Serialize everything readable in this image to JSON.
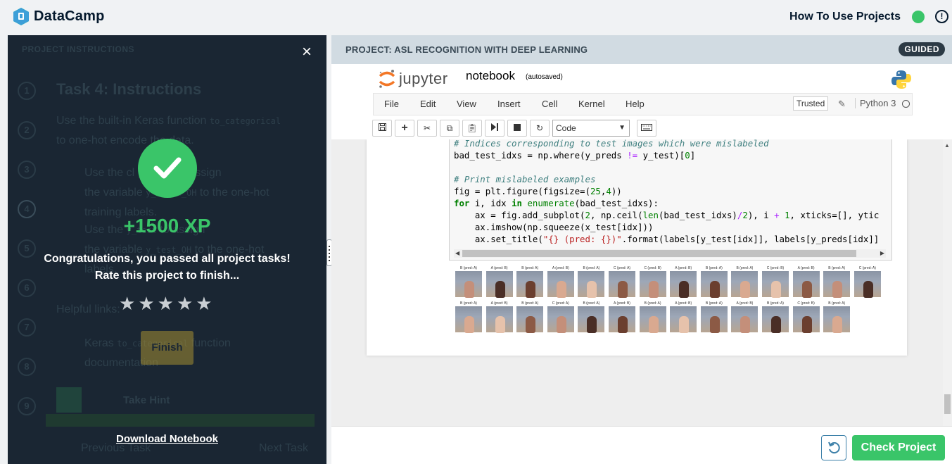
{
  "app": {
    "brand": "DataCamp"
  },
  "header": {
    "how_to": "How To Use Projects",
    "status_color": "#3ac569",
    "alert_icon": "!"
  },
  "left_panel": {
    "section_label": "PROJECT INSTRUCTIONS",
    "steps": [
      "1",
      "2",
      "3",
      "4",
      "5",
      "6",
      "7",
      "8",
      "9"
    ],
    "task_title": "Task 4: Instructions",
    "intro_line1": "Use the built-in Keras function",
    "intro_code": "to_categorical",
    "intro_line2": "to one-hot encode the data.",
    "bullet1_a": "Use the cl",
    "bullet1_code": "y_train",
    "bullet1_b": "to assign",
    "bullet1_c": "the variable",
    "bullet1_code2": "y_train_OH",
    "bullet1_d": "to the one-hot",
    "bullet1_e": "training labels.",
    "bullet2_a": "Use the",
    "bullet2_code": "y_test",
    "bullet2_b": "to assign",
    "bullet2_c": "the variable",
    "bullet2_code2": "y_test_OH",
    "bullet2_d": "to the one-hot",
    "bullet2_e": "labels.",
    "helpful_links": "Helpful links:",
    "link_a": "Keras",
    "link_code": "to_categorical",
    "link_b": "function",
    "link_c": "documentation",
    "bg_finish": "Finish",
    "take_hint": "Take Hint",
    "previous": "Previous Task",
    "next": "Next Task"
  },
  "modal": {
    "close_icon": "×",
    "xp": "+1500 XP",
    "congrats_line1": "Congratulations, you passed all project tasks!",
    "congrats_line2": "Rate this project to finish...",
    "stars": 5,
    "download": "Download Notebook"
  },
  "project": {
    "title": "PROJECT: ASL RECOGNITION WITH DEEP LEARNING",
    "badge": "GUIDED"
  },
  "jupyter": {
    "logo_text": "jupyter",
    "notebook_name": "notebook",
    "autosaved": "(autosaved)",
    "menu": [
      "File",
      "Edit",
      "View",
      "Insert",
      "Cell",
      "Kernel",
      "Help"
    ],
    "trusted": "Trusted",
    "kernel": "Python 3",
    "cell_type": "Code",
    "code": [
      "# Indices corresponding to test images which were mislabeled",
      "bad_test_idxs = np.where(y_preds != y_test)[0]",
      "",
      "# Print mislabeled examples",
      "fig = plt.figure(figsize=(25,4))",
      "for i, idx in enumerate(bad_test_idxs):",
      "    ax = fig.add_subplot(2, np.ceil(len(bad_test_idxs)/2), i + 1, xticks=[], ytic",
      "    ax.imshow(np.squeeze(x_test[idx]))",
      "    ax.set_title(\"{} (pred: {})\".format(labels[y_test[idx]], labels[y_preds[idx]]"
    ],
    "row1_labels": [
      "B (pred: A)",
      "A (pred: B)",
      "B (pred: A)",
      "A (pred: B)",
      "B (pred: A)",
      "C (pred: A)",
      "C (pred: B)",
      "A (pred: B)",
      "B (pred: A)",
      "B (pred: A)",
      "C (pred: B)",
      "A (pred: B)",
      "B (pred: A)",
      "C (pred: A)"
    ],
    "row2_labels": [
      "B (pred: A)",
      "A (pred: B)",
      "B (pred: A)",
      "C (pred: A)",
      "B (pred: A)",
      "A (pred: B)",
      "B (pred: A)",
      "A (pred: B)",
      "B (pred: A)",
      "A (pred: B)",
      "B (pred: A)",
      "C (pred: B)",
      "B (pred: A)"
    ]
  },
  "footer": {
    "check_project": "Check Project",
    "accent": "#3ac569"
  }
}
